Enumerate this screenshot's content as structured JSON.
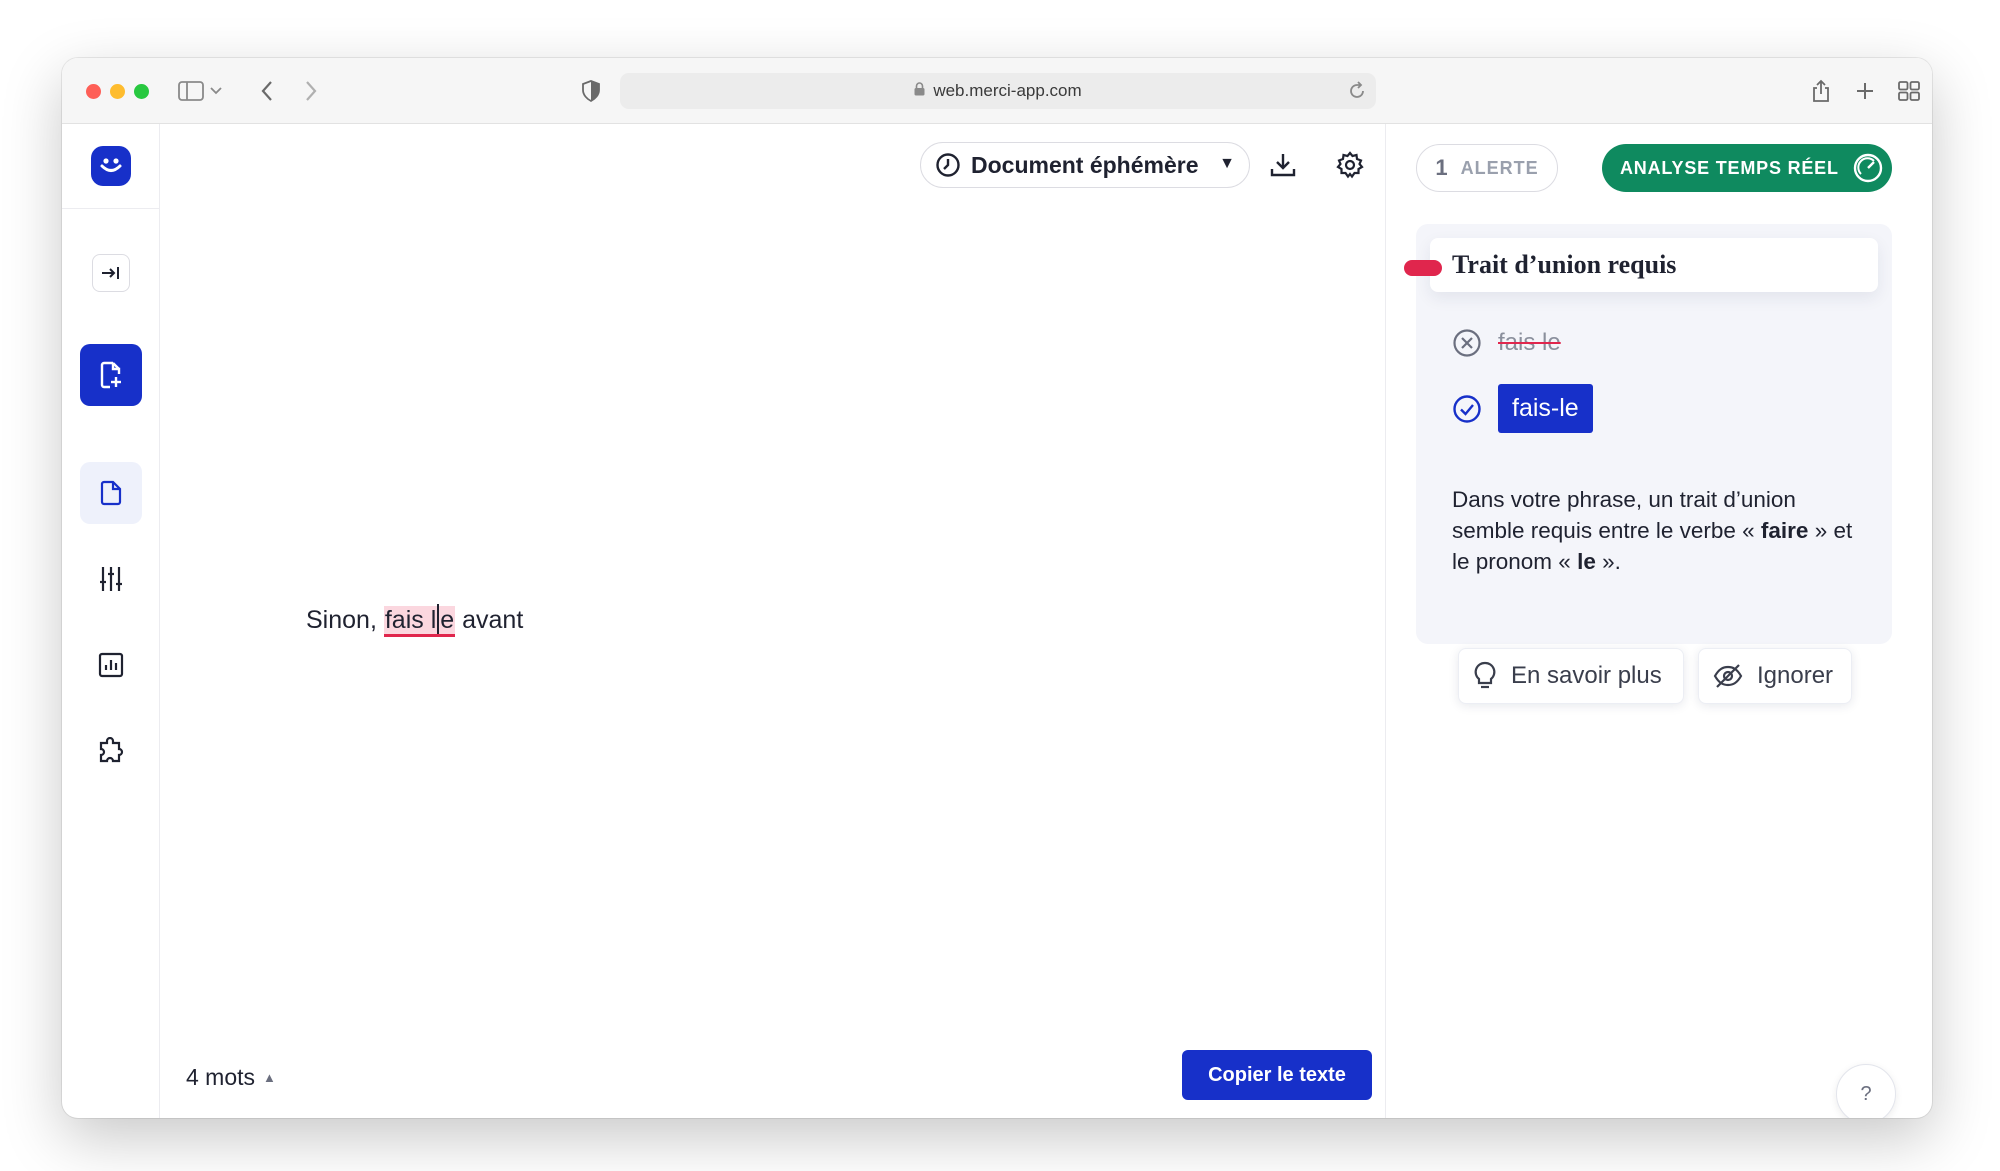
{
  "browser": {
    "url": "web.merci-app.com"
  },
  "editor": {
    "document_type": "Document éphémère",
    "text_before": "Sinon, ",
    "highlight_part1": "fais l",
    "highlight_part2": "e",
    "text_after": " avant",
    "word_count": "4 mots",
    "copy_label": "Copier le texte"
  },
  "panel": {
    "alert_count": "1",
    "alert_label": "ALERTE",
    "analyse_label": "ANALYSE TEMPS RÉEL",
    "card": {
      "title": "Trait d’union requis",
      "wrong_option": "fais le",
      "suggestion": "fais-le",
      "explanation_part1": "Dans votre phrase, un trait d’union semble requis entre le verbe « ",
      "explanation_bold1": "faire",
      "explanation_part2": " » et le pronom « ",
      "explanation_bold2": "le",
      "explanation_part3": " »."
    },
    "learn_more_label": "En savoir plus",
    "ignore_label": "Ignorer",
    "help_label": "?"
  },
  "colors": {
    "brand_blue": "#1730c9",
    "analyse_green": "#0f8a5f",
    "error_red": "#e0264d"
  }
}
